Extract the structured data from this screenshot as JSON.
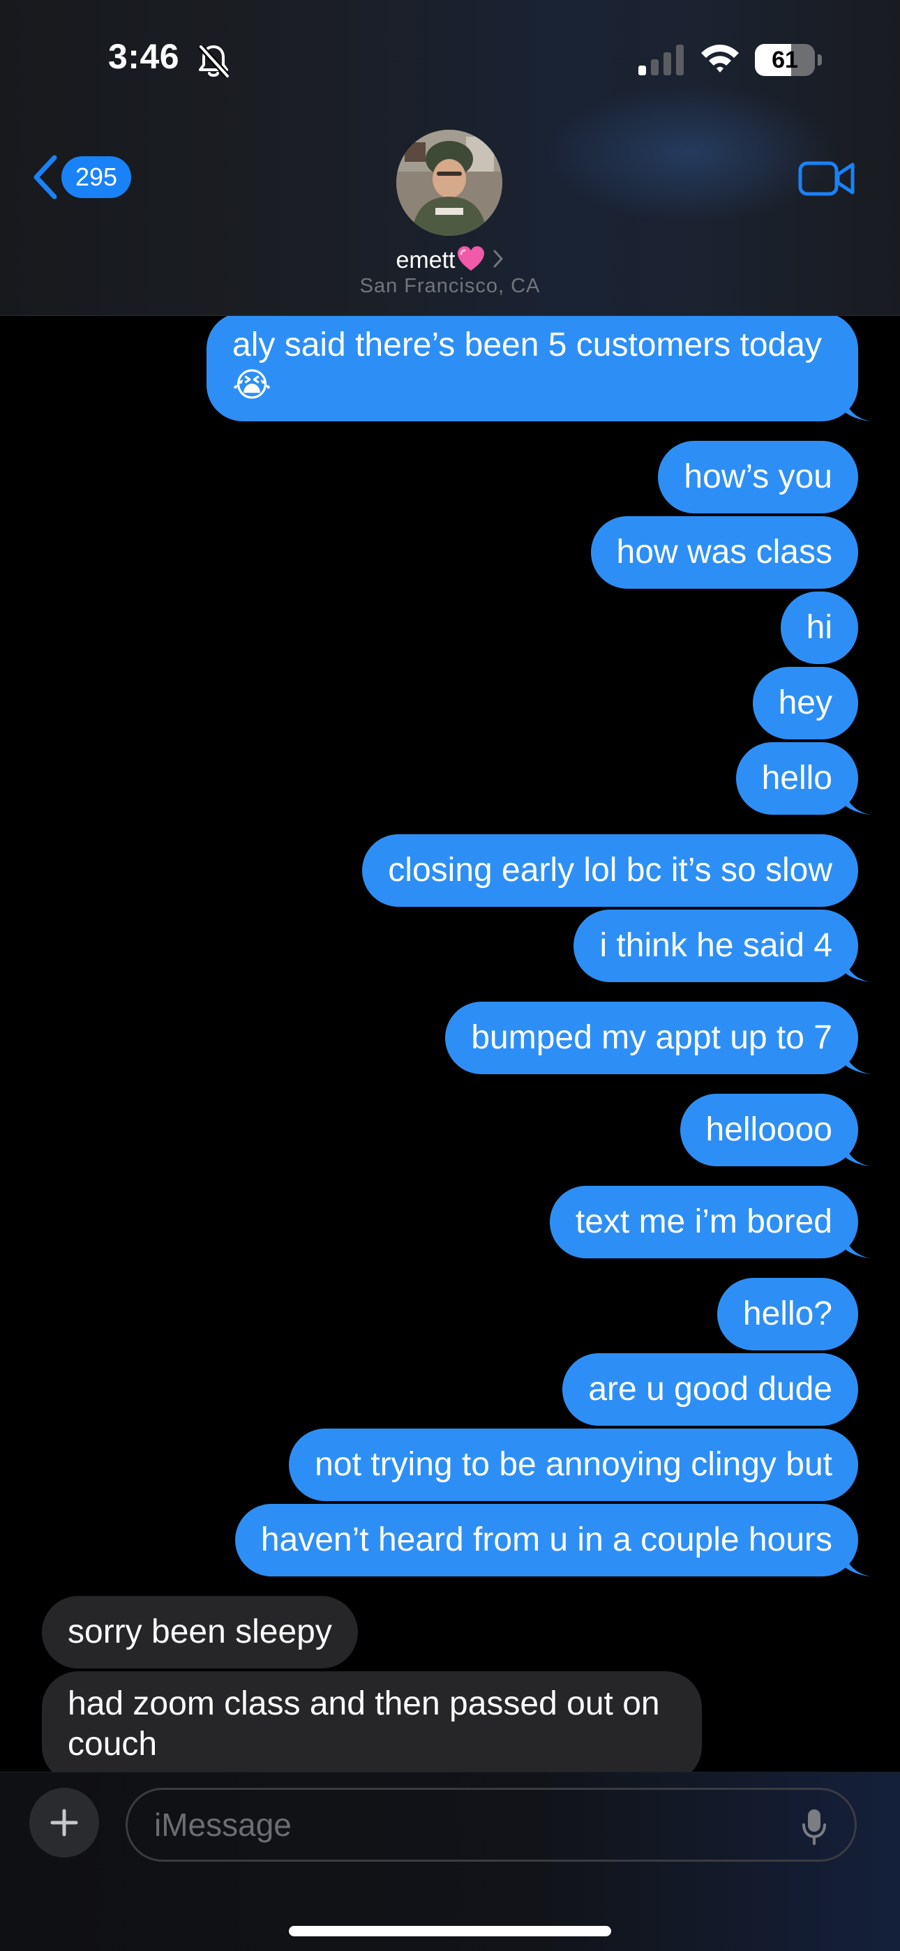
{
  "status_bar": {
    "time": "3:46",
    "battery_percent": "61",
    "battery_level": 0.61
  },
  "header": {
    "back_count": "295",
    "contact_name": "emett",
    "contact_location": "San Francisco, CA"
  },
  "messages": [
    {
      "direction": "out",
      "text": "aly said there’s been 5 customers today 😭"
    },
    {
      "direction": "out",
      "text": "how’s you"
    },
    {
      "direction": "out",
      "text": "how was class"
    },
    {
      "direction": "out",
      "text": "hi"
    },
    {
      "direction": "out",
      "text": "hey"
    },
    {
      "direction": "out",
      "text": "hello"
    },
    {
      "direction": "out",
      "text": "closing early lol bc it’s so slow"
    },
    {
      "direction": "out",
      "text": "i think he said 4"
    },
    {
      "direction": "out",
      "text": "bumped my appt up to 7"
    },
    {
      "direction": "out",
      "text": "helloooo"
    },
    {
      "direction": "out",
      "text": "text me i’m bored"
    },
    {
      "direction": "out",
      "text": "hello?"
    },
    {
      "direction": "out",
      "text": "are u good dude"
    },
    {
      "direction": "out",
      "text": "not trying to be annoying clingy but"
    },
    {
      "direction": "out",
      "text": "haven’t heard from u in a couple hours"
    },
    {
      "direction": "in",
      "text": "sorry been sleepy"
    },
    {
      "direction": "in",
      "text": "had zoom class and then passed out on couch"
    }
  ],
  "composer": {
    "placeholder": "iMessage"
  },
  "colors": {
    "outgoing_bubble": "#2d8ff5",
    "incoming_bubble": "#262628",
    "accent": "#1a82f7"
  }
}
